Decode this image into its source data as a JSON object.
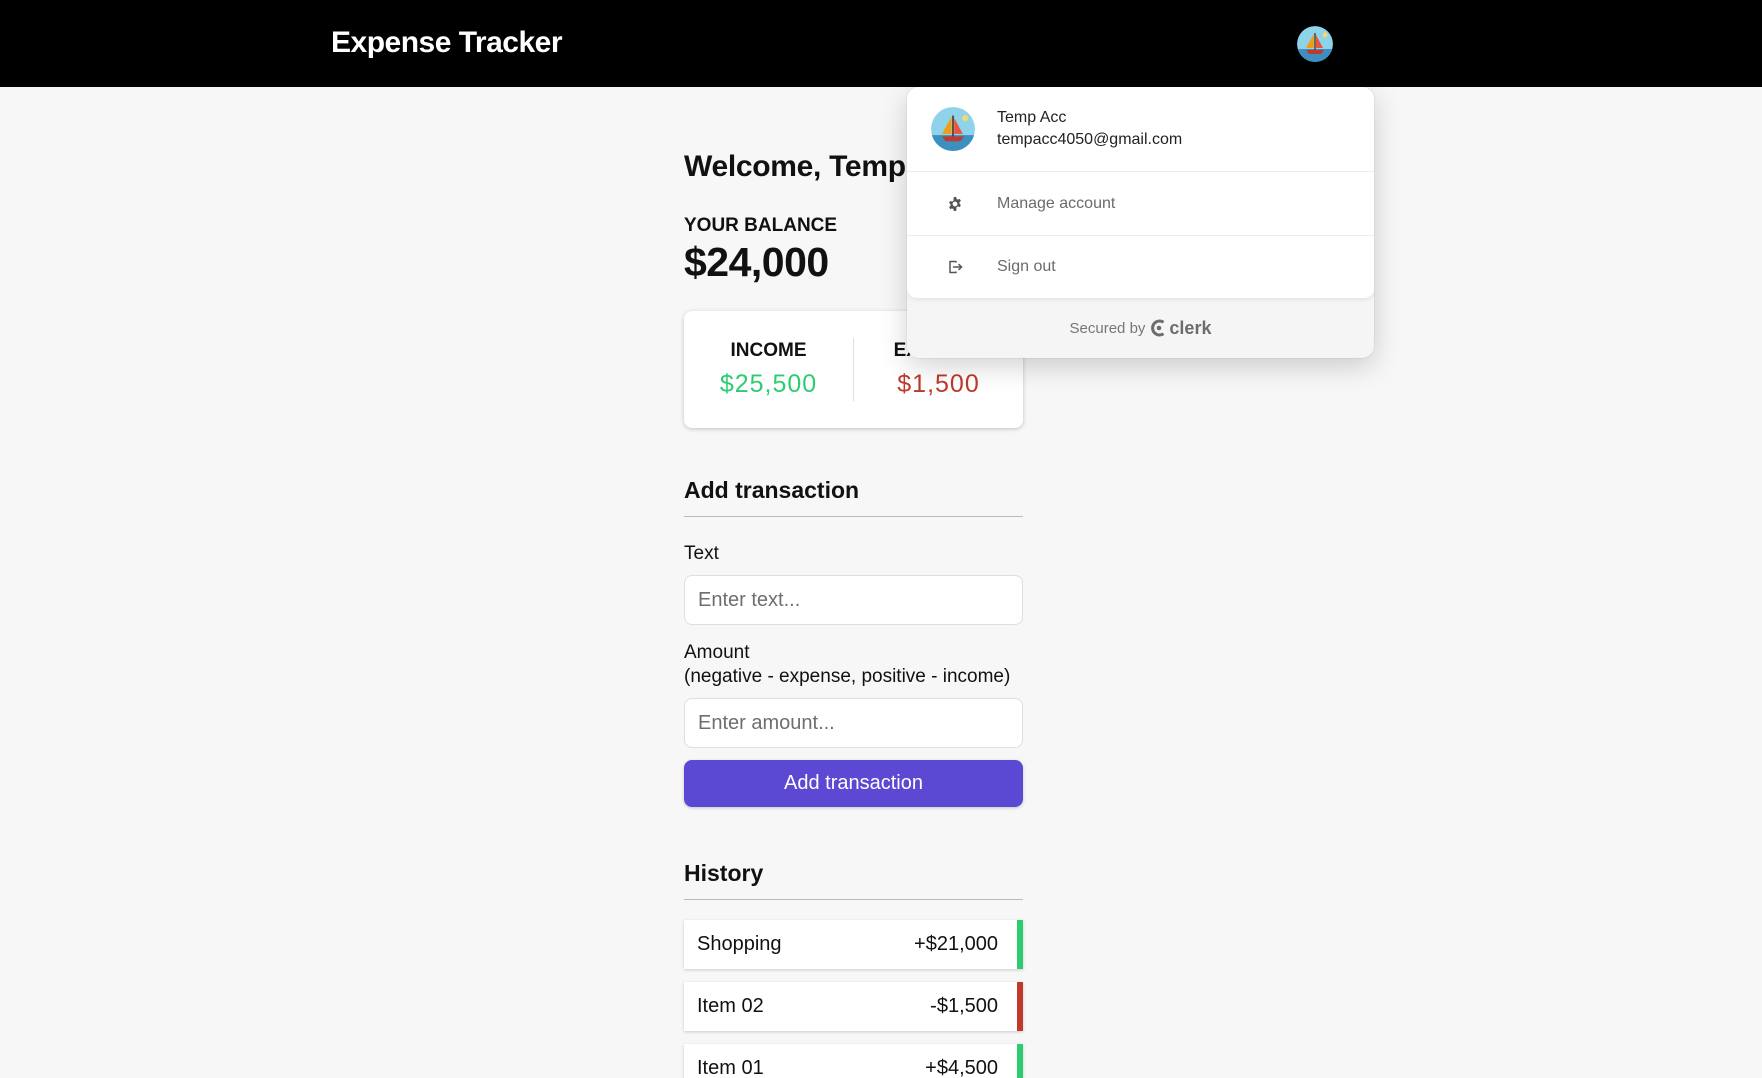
{
  "navbar": {
    "brand": "Expense Tracker"
  },
  "main": {
    "welcome": "Welcome, Temp",
    "balance_label": "Your Balance",
    "balance_amount": "$24,000",
    "income_label": "Income",
    "income_amount": "$25,500",
    "expense_label": "Expense",
    "expense_amount": "$1,500"
  },
  "add_transaction": {
    "title": "Add transaction",
    "text_label": "Text",
    "text_placeholder": "Enter text...",
    "amount_label": "Amount",
    "amount_hint": "(negative - expense, positive - income)",
    "amount_placeholder": "Enter amount...",
    "submit_label": "Add transaction"
  },
  "history": {
    "title": "History",
    "items": [
      {
        "text": "Shopping",
        "amount": "+$21,000",
        "type": "plus"
      },
      {
        "text": "Item 02",
        "amount": "-$1,500",
        "type": "minus"
      },
      {
        "text": "Item 01",
        "amount": "+$4,500",
        "type": "plus"
      }
    ]
  },
  "user_menu": {
    "name": "Temp Acc",
    "email": "tempacc4050@gmail.com",
    "manage_label": "Manage account",
    "signout_label": "Sign out",
    "secured_by": "Secured by",
    "provider": "clerk"
  },
  "colors": {
    "navbar_bg": "#000000",
    "primary": "#5b48d3",
    "income": "#2ecc71",
    "expense": "#c0392b",
    "page_bg": "#f7f7f7"
  },
  "icons": {
    "avatar": "sailboat-avatar-icon",
    "manage": "gear-icon",
    "signout": "sign-out-icon",
    "provider_logo": "clerk-logo-icon"
  }
}
